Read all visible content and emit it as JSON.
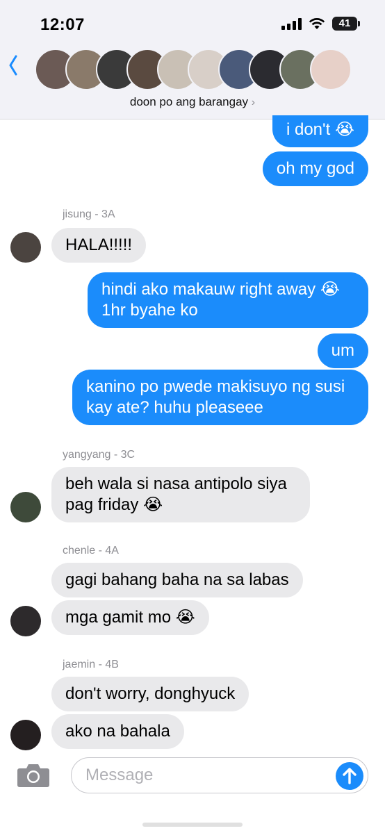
{
  "status_bar": {
    "time": "12:07",
    "battery": "41"
  },
  "header": {
    "group_name": "doon po ang barangay",
    "chevron": "›",
    "back_icon": "chevron-left-icon",
    "avatar_colors": [
      "#6b5a55",
      "#8a7a6a",
      "#3a3a3a",
      "#5a4a40",
      "#c9c0b5",
      "#d8cfc8",
      "#4a5a7a",
      "#2b2b30",
      "#6a7060",
      "#e7d0c8"
    ]
  },
  "messages": [
    {
      "dir": "out",
      "text": "i don't 😭"
    },
    {
      "dir": "out",
      "text": "oh my god"
    },
    {
      "dir": "in",
      "sender": "jisung - 3A",
      "text": "HALA!!!!!"
    },
    {
      "dir": "out",
      "text": "hindi ako makauw right away 😭 1hr byahe ko"
    },
    {
      "dir": "out",
      "text": "um"
    },
    {
      "dir": "out",
      "text": "kanino po pwede makisuyo ng susi kay ate? huhu pleaseee"
    },
    {
      "dir": "in",
      "sender": "yangyang - 3C",
      "text": "beh wala si nasa antipolo siya pag friday 😭"
    },
    {
      "dir": "in",
      "sender": "chenle - 4A",
      "text": "gagi bahang baha na sa labas"
    },
    {
      "dir": "in",
      "text": "mga gamit mo 😭"
    },
    {
      "dir": "in",
      "sender": "jaemin - 4B",
      "text": "don't worry, donghyuck"
    },
    {
      "dir": "in",
      "text": "ako na bahala"
    }
  ],
  "composer": {
    "placeholder": "Message",
    "camera_icon": "camera-icon",
    "send_icon": "arrow-up-icon"
  },
  "colors": {
    "outgoing": "#1b8cfb",
    "incoming": "#e9e9eb",
    "accent": "#1a8cff"
  }
}
